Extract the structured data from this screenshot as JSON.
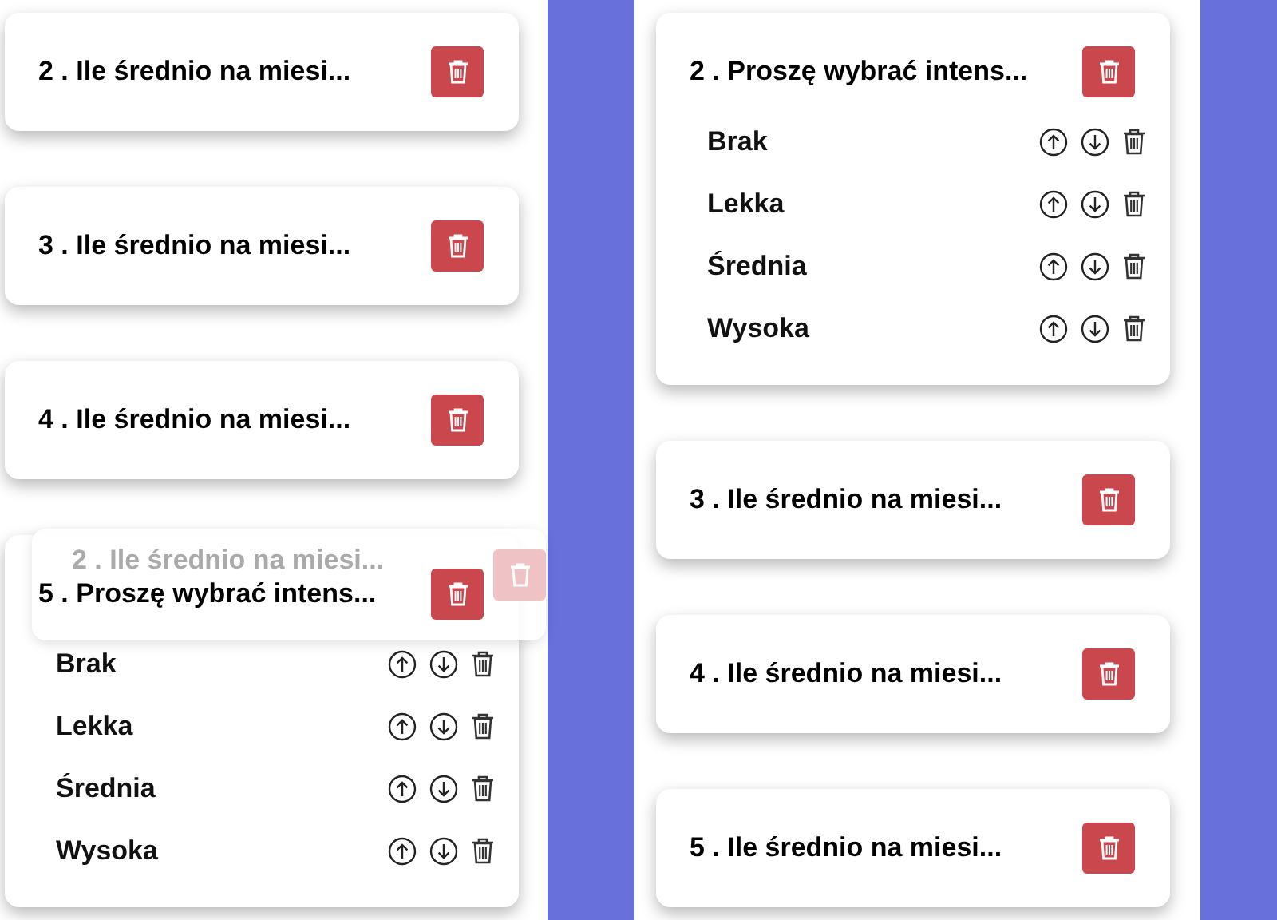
{
  "columns": [
    {
      "questions": [
        {
          "title": "2 . Ile średnio na miesi..."
        },
        {
          "title": "3 . Ile średnio na miesi..."
        },
        {
          "title": "4 . Ile średnio na miesi..."
        },
        {
          "title": "5 . Proszę wybrać intens...",
          "options": [
            "Brak",
            "Lekka",
            "Średnia",
            "Wysoka"
          ]
        }
      ],
      "drag_preview": {
        "title": "2 . Ile średnio na miesi..."
      }
    },
    {
      "questions": [
        {
          "title": "2 . Proszę wybrać intens...",
          "options": [
            "Brak",
            "Lekka",
            "Średnia",
            "Wysoka"
          ]
        },
        {
          "title": "3 . Ile średnio na miesi..."
        },
        {
          "title": "4 . Ile średnio na miesi..."
        },
        {
          "title": "5 . Ile średnio na miesi..."
        }
      ]
    }
  ]
}
